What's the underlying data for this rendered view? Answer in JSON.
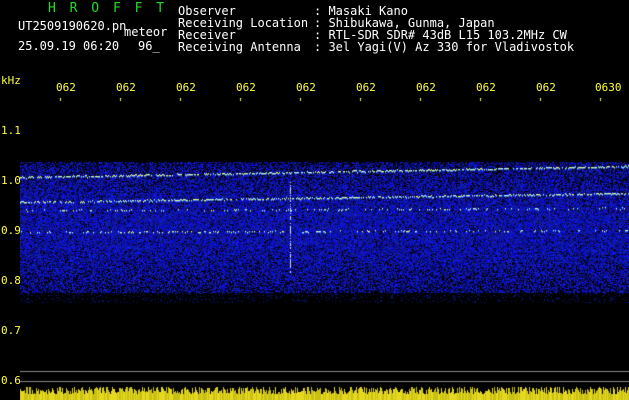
{
  "app": {
    "name": "H R O F F T"
  },
  "file": {
    "name": "UT2509190620.pn",
    "suffix": "meteor",
    "date_time": "25.09.19 06:20",
    "value": "96_"
  },
  "station": {
    "observer_label": "Observer",
    "observer_value": ": Masaki Kano",
    "location_label": "Receiving Location",
    "location_value": ": Shibukawa, Gunma, Japan",
    "receiver_label": "Receiver",
    "receiver_value": ": RTL-SDR SDR# 43dB L15 103.2MHz CW",
    "antenna_label": "Receiving Antenna",
    "antenna_value": ": 3el Yagi(V) Az 330 for Vladivostok"
  },
  "axes": {
    "y_unit": "kHz",
    "y_ticks": [
      "1.1",
      "1.0",
      "0.9",
      "0.8",
      "0.7",
      "0.6"
    ],
    "x_ticks": [
      "062",
      "062",
      "062",
      "062",
      "062",
      "062",
      "062",
      "062",
      "062",
      "0630"
    ]
  },
  "colors": {
    "label_yellow": "#ffff33",
    "title_green": "#22dd22",
    "signal_blue": "#1a2fd0",
    "meteor_trace": "#ffff66"
  }
}
